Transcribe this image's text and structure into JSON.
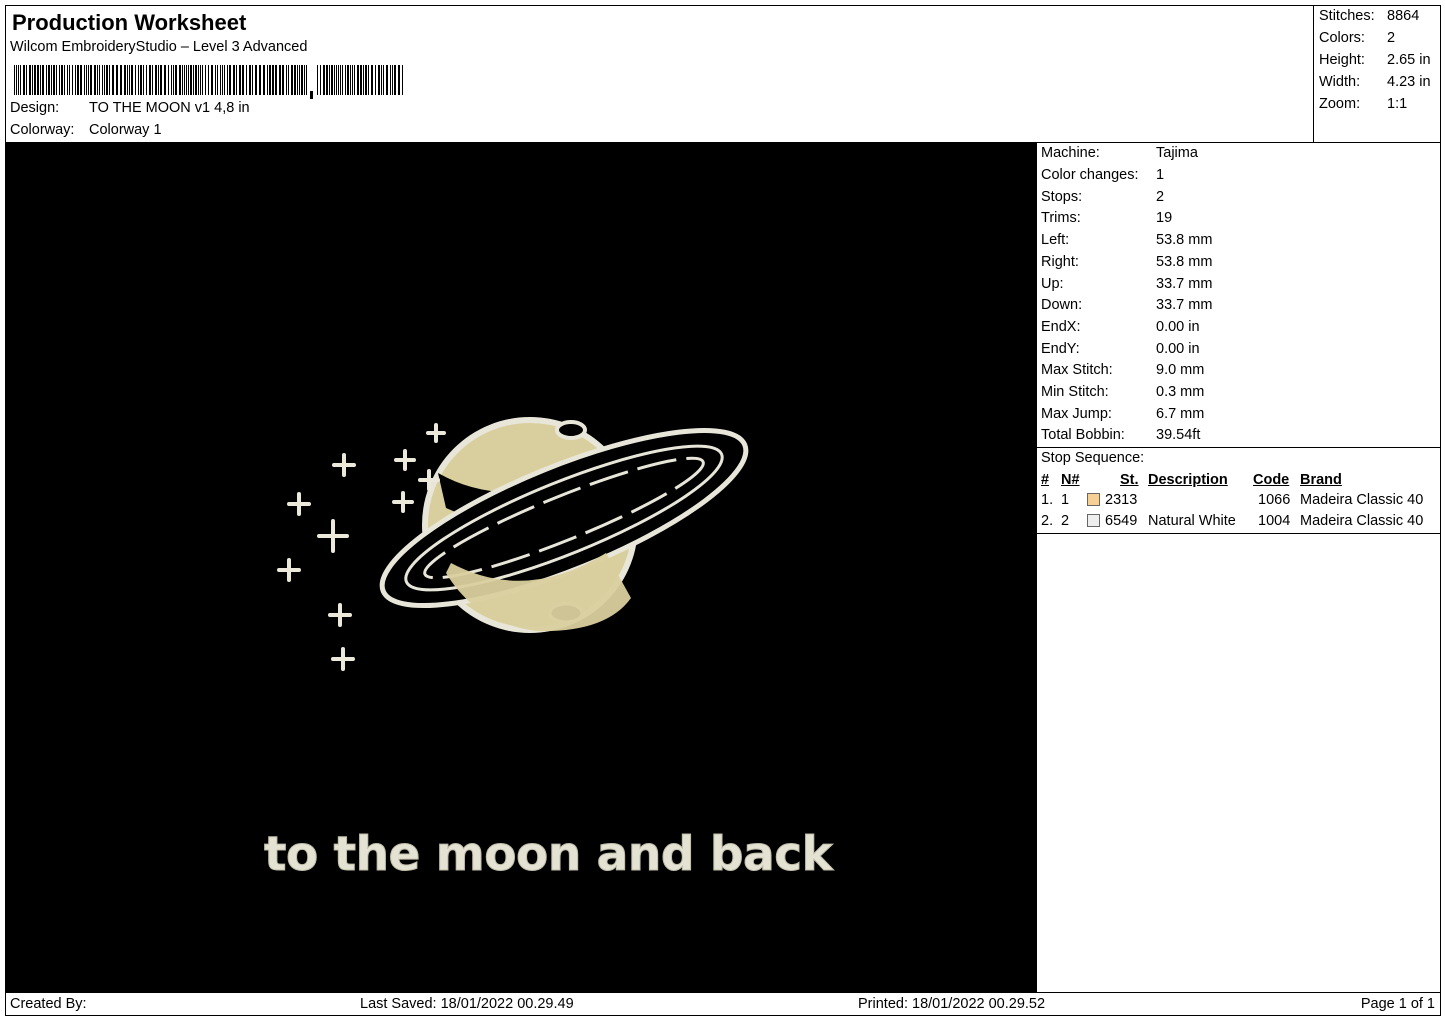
{
  "header": {
    "title": "Production Worksheet",
    "subtitle": "Wilcom EmbroideryStudio – Level 3 Advanced",
    "design_label": "Design:",
    "design_value": "TO THE MOON v1 4,8 in",
    "colorway_label": "Colorway:",
    "colorway_value": "Colorway 1"
  },
  "stats": {
    "stitches_label": "Stitches:",
    "stitches": "8864",
    "colors_label": "Colors:",
    "colors": "2",
    "height_label": "Height:",
    "height": "2.65 in",
    "width_label": "Width:",
    "width": "4.23 in",
    "zoom_label": "Zoom:",
    "zoom": "1:1"
  },
  "design": {
    "text": "to the moon and back",
    "background_color": "#000000",
    "fill_color": "#ddd2a0",
    "outline_color": "#e8e6d8"
  },
  "machine": {
    "machine_label": "Machine:",
    "machine": "Tajima",
    "color_changes_label": "Color changes:",
    "color_changes": "1",
    "stops_label": "Stops:",
    "stops": "2",
    "trims_label": "Trims:",
    "trims": "19",
    "left_label": "Left:",
    "left": "53.8 mm",
    "right_label": "Right:",
    "right": "53.8 mm",
    "up_label": "Up:",
    "up": "33.7 mm",
    "down_label": "Down:",
    "down": "33.7 mm",
    "endx_label": "EndX:",
    "endx": "0.00 in",
    "endy_label": "EndY:",
    "endy": "0.00 in",
    "max_stitch_label": "Max Stitch:",
    "max_stitch": "9.0 mm",
    "min_stitch_label": "Min Stitch:",
    "min_stitch": "0.3 mm",
    "max_jump_label": "Max Jump:",
    "max_jump": "6.7 mm",
    "total_bobbin_label": "Total Bobbin:",
    "total_bobbin": "39.54ft"
  },
  "stop_sequence": {
    "title": "Stop Sequence:",
    "headers": {
      "num": "#",
      "n": "N#",
      "st": "St.",
      "description": "Description",
      "code": "Code",
      "brand": "Brand"
    },
    "rows": [
      {
        "num": "1.",
        "n": "1",
        "swatch": "#f4cf96",
        "st": "2313",
        "description": "",
        "code": "1066",
        "brand": "Madeira Classic 40"
      },
      {
        "num": "2.",
        "n": "2",
        "swatch": "#eeeeee",
        "st": "6549",
        "description": "Natural White",
        "code": "1004",
        "brand": "Madeira Classic 40"
      }
    ]
  },
  "footer": {
    "created_by": "Created By:",
    "last_saved": "Last Saved: 18/01/2022 00.29.49",
    "printed": "Printed: 18/01/2022 00.29.52",
    "page": "Page 1 of 1"
  }
}
